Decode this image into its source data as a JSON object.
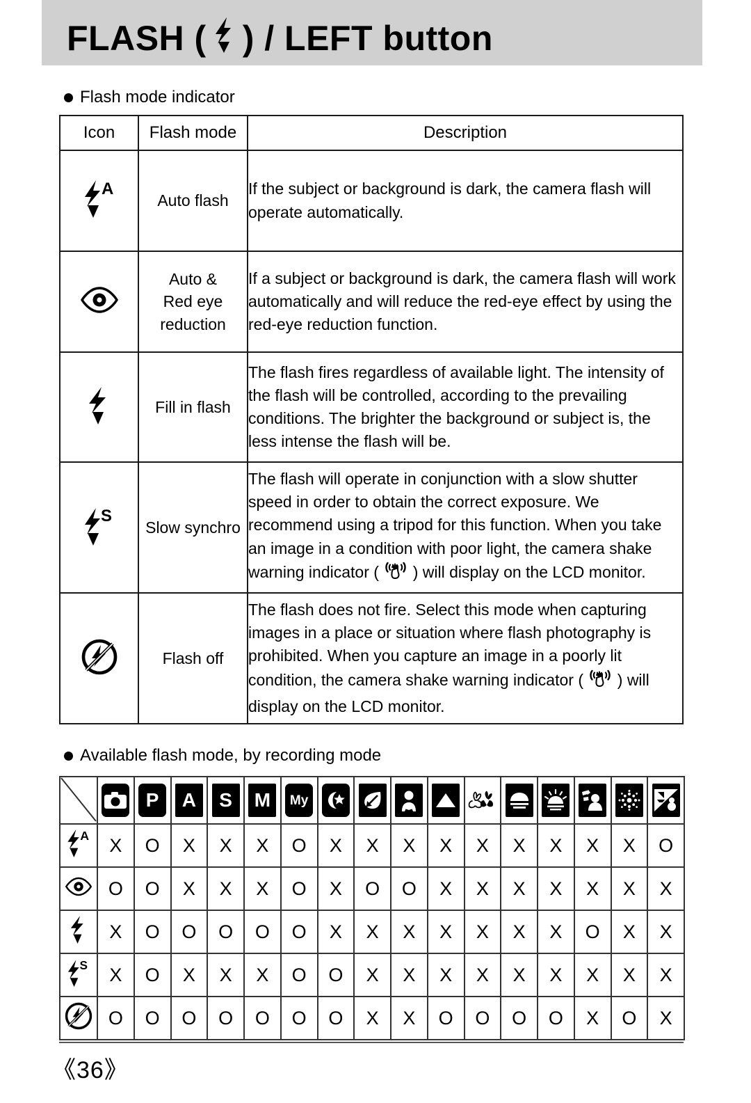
{
  "header": {
    "title_before": "FLASH (",
    "icon": "flash-bolt-icon",
    "title_after": ") / LEFT button"
  },
  "section1": {
    "bullet_label": "Flash mode indicator",
    "columns": [
      "Icon",
      "Flash mode",
      "Description"
    ],
    "rows": [
      {
        "icon": "flash-auto-icon",
        "mode": "Auto flash",
        "description": "If the subject or background is dark, the camera flash will operate automatically."
      },
      {
        "icon": "red-eye-reduction-icon",
        "mode": "Auto &\nRed eye\nreduction",
        "mode_line1": "Auto &",
        "mode_line2": "Red eye",
        "mode_line3": "reduction",
        "description": "If a subject or background is dark, the camera flash will work automatically and will reduce the red-eye effect by using the red-eye reduction function."
      },
      {
        "icon": "fill-in-flash-icon",
        "mode": "Fill in flash",
        "description": "The flash fires regardless of available light. The intensity of the flash will be controlled, according to the prevailing conditions. The brighter the background or subject is, the less intense the flash will be."
      },
      {
        "icon": "slow-synchro-icon",
        "mode": "Slow synchro",
        "desc_part1": "The flash will operate in conjunction with a slow shutter speed in order to obtain the correct exposure. We recommend using a tripod for this function. When you take an image in a condition with poor light, the camera shake warning indicator (",
        "desc_inline_icon": "camera-shake-warning-icon",
        "desc_part2": ") will display on the LCD monitor."
      },
      {
        "icon": "flash-off-icon",
        "mode": "Flash off",
        "desc_part1": "The flash does not fire. Select this mode when capturing images in a place or situation where flash photography is prohibited. When you capture an image in a poorly lit condition, the camera shake warning indicator (",
        "desc_inline_icon": "camera-shake-warning-icon",
        "desc_part2": ") will display on the LCD monitor."
      }
    ]
  },
  "section2": {
    "bullet_label": "Available flash mode, by recording mode",
    "mode_columns": [
      {
        "name": "auto-mode-icon",
        "label": ""
      },
      {
        "name": "program-mode-icon",
        "label": "P"
      },
      {
        "name": "aperture-mode-icon",
        "label": "A"
      },
      {
        "name": "shutter-mode-icon",
        "label": "S"
      },
      {
        "name": "manual-mode-icon",
        "label": "M"
      },
      {
        "name": "my-set-mode-icon",
        "label": "My"
      },
      {
        "name": "night-mode-icon",
        "label": ""
      },
      {
        "name": "sport-mode-icon",
        "label": ""
      },
      {
        "name": "portrait-mode-icon",
        "label": ""
      },
      {
        "name": "landscape-mode-icon",
        "label": ""
      },
      {
        "name": "close-up-mode-icon",
        "label": ""
      },
      {
        "name": "sunset-mode-icon",
        "label": ""
      },
      {
        "name": "dawn-mode-icon",
        "label": ""
      },
      {
        "name": "backlight-mode-icon",
        "label": ""
      },
      {
        "name": "fireworks-mode-icon",
        "label": ""
      },
      {
        "name": "beach-snow-mode-icon",
        "label": ""
      }
    ],
    "flash_rows": [
      {
        "icon": "flash-auto-icon",
        "values": [
          "X",
          "O",
          "X",
          "X",
          "X",
          "O",
          "X",
          "X",
          "X",
          "X",
          "X",
          "X",
          "X",
          "X",
          "X",
          "O"
        ]
      },
      {
        "icon": "red-eye-reduction-icon",
        "values": [
          "O",
          "O",
          "X",
          "X",
          "X",
          "O",
          "X",
          "O",
          "O",
          "X",
          "X",
          "X",
          "X",
          "X",
          "X",
          "X"
        ]
      },
      {
        "icon": "fill-in-flash-icon",
        "values": [
          "X",
          "O",
          "O",
          "O",
          "O",
          "O",
          "X",
          "X",
          "X",
          "X",
          "X",
          "X",
          "X",
          "O",
          "X",
          "X"
        ]
      },
      {
        "icon": "slow-synchro-icon",
        "values": [
          "X",
          "O",
          "X",
          "X",
          "X",
          "O",
          "O",
          "X",
          "X",
          "X",
          "X",
          "X",
          "X",
          "X",
          "X",
          "X"
        ]
      },
      {
        "icon": "flash-off-icon",
        "values": [
          "O",
          "O",
          "O",
          "O",
          "O",
          "O",
          "O",
          "X",
          "X",
          "O",
          "O",
          "O",
          "O",
          "X",
          "O",
          "X"
        ]
      }
    ]
  },
  "footer": {
    "page_number": "《36》"
  }
}
